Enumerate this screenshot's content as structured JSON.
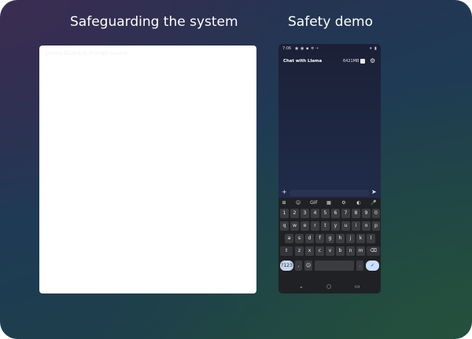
{
  "slide": {
    "left_title": "Safeguarding the system",
    "right_title": "Safety demo",
    "panel_ghost_text": "Llama Guard & Prompt Guard"
  },
  "phone": {
    "status": {
      "time": "7:06",
      "icons": [
        "alert-icon",
        "chat-icon",
        "message-icon",
        "settings-icon",
        "dot-icon",
        "wifi-icon",
        "battery-icon"
      ]
    },
    "appbar": {
      "title": "Chat with Llama",
      "memory": "6421MB",
      "gear": "⚙"
    },
    "input": {
      "plus": "+",
      "placeholder": "",
      "send": "➤"
    },
    "keyboard": {
      "tools": [
        "⊞",
        "☺",
        "GIF",
        "▦",
        "⚙",
        "◐",
        "🎤"
      ],
      "rows": [
        [
          "1",
          "2",
          "3",
          "4",
          "5",
          "6",
          "7",
          "8",
          "9",
          "0"
        ],
        [
          "q",
          "w",
          "e",
          "r",
          "t",
          "y",
          "u",
          "i",
          "o",
          "p"
        ],
        [
          "a",
          "s",
          "d",
          "f",
          "g",
          "h",
          "j",
          "k",
          "l"
        ],
        [
          "z",
          "x",
          "c",
          "v",
          "b",
          "n",
          "m"
        ]
      ],
      "shift": "⇧",
      "backspace": "⌫",
      "symbols": "?123",
      "comma": ",",
      "emoji": "☺",
      "period": ".",
      "enter": "✓"
    },
    "nav": {
      "back": "⌄",
      "home": "○",
      "recents": "▭"
    }
  }
}
